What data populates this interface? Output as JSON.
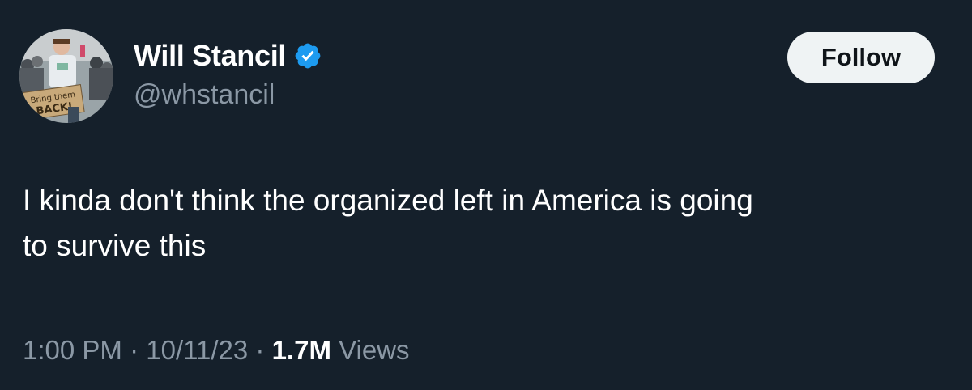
{
  "user": {
    "display_name": "Will Stancil",
    "handle": "@whstancil",
    "verified_icon": "verified-badge-icon",
    "verified_color": "#1d9bf0",
    "avatar_sign_line1": "Bring them",
    "avatar_sign_line2": "BACK!"
  },
  "actions": {
    "follow_label": "Follow"
  },
  "tweet": {
    "text": "I kinda don't think the organized left in America is going\nto survive this"
  },
  "meta": {
    "time": "1:00 PM",
    "sep1": " · ",
    "date": "10/11/23",
    "sep2": " · ",
    "views_count": "1.7M",
    "views_label": " Views"
  },
  "colors": {
    "background": "#15202b",
    "primary_text": "#ffffff",
    "secondary_text": "#8b98a5",
    "button_bg": "#eff3f4",
    "button_text": "#0f1419"
  }
}
